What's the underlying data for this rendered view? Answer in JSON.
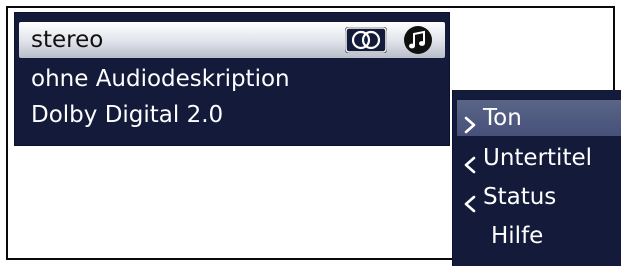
{
  "audio_panel": {
    "rows": [
      {
        "label": "stereo"
      },
      {
        "label": "ohne Audiodeskription"
      },
      {
        "label": "Dolby Digital 2.0"
      }
    ],
    "icons": [
      "stereo-icon",
      "music-note-icon"
    ]
  },
  "menu": {
    "items": [
      {
        "label": "Ton",
        "icon": "chevron-right-icon"
      },
      {
        "label": "Untertitel",
        "icon": "chevron-left-icon"
      },
      {
        "label": "Status",
        "icon": "chevron-left-icon"
      },
      {
        "label": "Hilfe",
        "icon": ""
      }
    ]
  },
  "colors": {
    "panel_background": "#141b3a",
    "selected_row": "#dfe2ea",
    "selected_menu_item": "#4e5980",
    "text": "#ffffff"
  }
}
